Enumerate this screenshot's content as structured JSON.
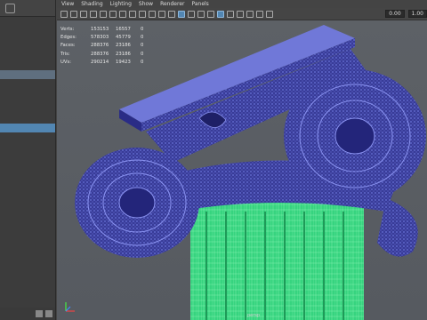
{
  "menu": [
    "View",
    "Shading",
    "Lighting",
    "Show",
    "Renderer",
    "Panels"
  ],
  "toolbar": {
    "field1": "0.00",
    "field2": "1.00"
  },
  "hud": {
    "rows": [
      {
        "label": "Verts:",
        "c1": "153153",
        "c2": "16557",
        "c3": "0"
      },
      {
        "label": "Edges:",
        "c1": "578303",
        "c2": "45779",
        "c3": "0"
      },
      {
        "label": "Faces:",
        "c1": "288376",
        "c2": "23186",
        "c3": "0"
      },
      {
        "label": "Tris:",
        "c1": "288376",
        "c2": "23186",
        "c3": "0"
      },
      {
        "label": "UVs:",
        "c1": "290214",
        "c2": "19423",
        "c3": "0"
      }
    ]
  },
  "camera_label": "persp",
  "colors": {
    "wire": "#2c2d8a",
    "wire_line": "#7f86e6",
    "column": "#3fe08a"
  }
}
